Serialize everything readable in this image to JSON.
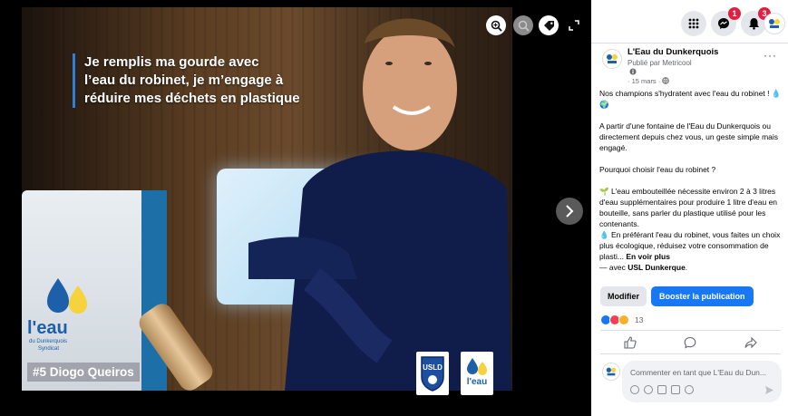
{
  "viewer": {
    "headline": [
      "Je remplis ma gourde avec",
      "l’eau du robinet, je m’engage à",
      "réduire mes déchets en plastique"
    ],
    "player_badge": "#5 Diogo Queiros",
    "fountain_logo_lines": [
      "l'eau",
      "du Dunkerquois",
      "Syndicat"
    ],
    "club_logo": "USLD",
    "brand_logo": "l'eau"
  },
  "topbar": {
    "messenger_count": "1",
    "notifications_count": "3"
  },
  "post": {
    "page_name": "L'Eau du Dunkerquois",
    "published_by": "Publié par Metricool",
    "date": "15 mars",
    "paragraph1": "Nos champions s'hydratent avec l'eau du robinet ! 💧🌍",
    "paragraph2": "A partir d'une fontaine de l'Eau du Dunkerquois ou directement depuis chez vous, un geste simple mais engagé.",
    "paragraph3": "Pourquoi choisir l'eau du robinet ?",
    "point1": "🌱 L'eau embouteillée nécessite environ 2 à 3 litres d'eau supplémentaires pour produire 1 litre d'eau en bouteille, sans parler du plastique utilisé pour les contenants.",
    "point2": "💧 En préférant l'eau du robinet, vous faites un choix plus écologique, réduisez votre consommation de plasti...",
    "see_more": "En voir plus",
    "with_prefix": "— avec ",
    "with_name": "USL Dunkerque",
    "with_suffix": ".",
    "modify_label": "Modifier",
    "boost_label": "Booster la publication",
    "reaction_count": "13",
    "comment_placeholder": "Commenter en tant que L'Eau du Dun..."
  },
  "colors": {
    "accent": "#1877f2",
    "badge": "#e41e3f",
    "brand_blue": "#1d5fa8",
    "brand_yellow": "#f6d33c"
  }
}
